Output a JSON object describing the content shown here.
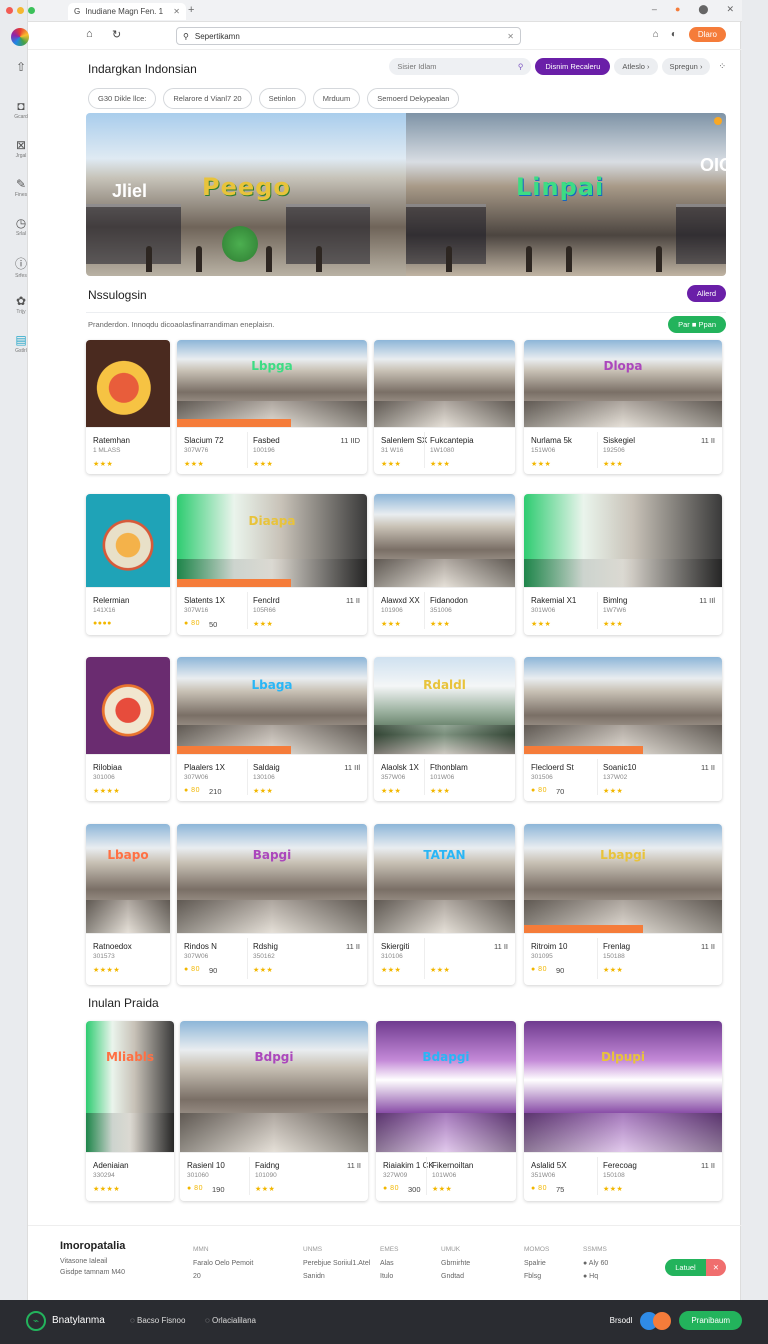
{
  "browser": {
    "tab_title": "Inudiane Magn Fen. 1",
    "url": "Sepertikamn",
    "new_tab": "+",
    "dot_colors": [
      "#f25c54",
      "#f5b730",
      "#3cc15a"
    ]
  },
  "sidebar": {
    "items": [
      {
        "icon": "rocket-icon",
        "glyph": "⇧",
        "label": ""
      },
      {
        "icon": "gamepad-icon",
        "glyph": "◘",
        "label": "Gcard"
      },
      {
        "icon": "tag-icon",
        "glyph": "⊠",
        "label": "Jrgal"
      },
      {
        "icon": "pen-icon",
        "glyph": "✎",
        "label": "Fines"
      },
      {
        "icon": "clock-icon",
        "glyph": "◷",
        "label": "Srlal"
      },
      {
        "icon": "info-icon",
        "glyph": "ⓘ",
        "label": "Srfes"
      },
      {
        "icon": "puzzle-icon",
        "glyph": "✿",
        "label": "Trijy"
      },
      {
        "icon": "folder-icon",
        "glyph": "▤",
        "label": "Gstlrl"
      }
    ]
  },
  "header": {
    "title": "Indargkan Indonsian",
    "search_placeholder": "Sisier Idlam",
    "primary_button": "Disnim Recaleru",
    "grey_button_1": "Atleslo",
    "grey_button_2": "Spregun",
    "action_button": "Dlaro"
  },
  "filters": [
    "G30 Dikle llce:",
    "Relarore d Vianl7 20",
    "Setinlon",
    "Mrduum",
    "Semoerd Dekypealan"
  ],
  "hero": {
    "left_word": "Peego",
    "left_sign": "Jliel",
    "right_word": "Linpai",
    "right_sign": "OIO"
  },
  "section1": {
    "title": "Nssulogsin",
    "pill": "Allerd",
    "hint": "Pranderdon. Innoqdu dicoaolasfinarrandiman eneplaisn.",
    "green_pill": "Par ■ Ppan"
  },
  "cards": [
    {
      "img": "food",
      "t1": "Ratemhan",
      "t2": "1 MLASS",
      "rating": "★★★"
    },
    {
      "img": "mall",
      "sign": "Lbpga",
      "t1": "Slacium 72",
      "t2": "307W76",
      "rating": "★★★",
      "t1b": "Fasbed",
      "t2b": "100196",
      "price": "11 IID",
      "band": true
    },
    {
      "img": "mall",
      "sign": "",
      "t1": "Salenlem SX",
      "t2": "31 W16",
      "rating": "★★★",
      "t1b": "Fukcantepia",
      "t2b": "1W1080",
      "price": ""
    },
    {
      "img": "mall",
      "sign": "Dlopa",
      "t1": "Nurlama 5k",
      "t2": "151W06",
      "rating": "★★★",
      "t1b": "Siskegiel",
      "t2b": "192506",
      "price": "11 II"
    },
    {
      "img": "plate",
      "t1": "Relermian",
      "t2": "141X16",
      "rating": "●●●●"
    },
    {
      "img": "mall-green",
      "sign": "Diaapa",
      "t1": "Slatents 1X",
      "t2": "307W16",
      "rating": "● 80",
      "t1b": "Fenclrd",
      "t2b": "105R66",
      "price": "11 II",
      "band": true,
      "extra": "50"
    },
    {
      "img": "mall",
      "sign": "",
      "t1": "Alawxd XX",
      "t2": "101906",
      "rating": "★★★",
      "t1b": "Fidanodon",
      "t2b": "351006",
      "price": ""
    },
    {
      "img": "mall-green",
      "sign": "",
      "t1": "Rakemial X1",
      "t2": "301W06",
      "rating": "★★★",
      "t1b": "Bimlng",
      "t2b": "1W7W6",
      "price": "11 IIl"
    },
    {
      "img": "plate-purple",
      "t1": "Rilobiaa",
      "t2": "301006",
      "rating": "★★★★"
    },
    {
      "img": "mall",
      "sign": "Lbaga",
      "t1": "Plaalers 1X",
      "t2": "307W06",
      "rating": "● 80",
      "t1b": "Saldaig",
      "t2b": "130106",
      "price": "11 IIl",
      "band": true,
      "extra": "210"
    },
    {
      "img": "mall-outdoor",
      "sign": "Rdaldl",
      "t1": "Alaolsk 1X",
      "t2": "357W06",
      "rating": "★★★",
      "t1b": "Fthonblam",
      "t2b": "101W06",
      "price": ""
    },
    {
      "img": "mall",
      "sign": "",
      "t1": "Flecloerd St",
      "t2": "301506",
      "rating": "● 80",
      "t1b": "Soanic10",
      "t2b": "137W02",
      "price": "11 II",
      "band": true,
      "extra": "70"
    },
    {
      "img": "mall",
      "sign": "Lbapo",
      "t1": "Ratnoedox",
      "t2": "301573",
      "rating": "★★★★"
    },
    {
      "img": "mall",
      "sign": "Bapgi",
      "t1": "Rindos N",
      "t2": "307W06",
      "rating": "● 80",
      "t1b": "Rdshig",
      "t2b": "350162",
      "price": "11 II",
      "extra": "90"
    },
    {
      "img": "mall",
      "sign": "TATAN",
      "t1": "Skiergiti",
      "t2": "310106",
      "rating": "★★★",
      "t1b": "",
      "t2b": "",
      "price": "11 II"
    },
    {
      "img": "mall",
      "sign": "Lbapgi",
      "t1": "Ritroim 10",
      "t2": "301095",
      "rating": "● 80",
      "t1b": "Frenlag",
      "t2b": "150188",
      "price": "11 II",
      "extra": "90",
      "band": true
    }
  ],
  "section2": {
    "title": "Inulan Praida"
  },
  "cards2": [
    {
      "img": "mall-green",
      "sign": "Mliabls",
      "t1": "Adeniaian",
      "t2": "330294",
      "rating": "★★★★"
    },
    {
      "img": "mall",
      "sign": "Bdpgi",
      "t1": "Rasienl 10",
      "t2": "301060",
      "rating": "● 80",
      "t1b": "Faidng",
      "t2b": "101090",
      "price": "11 II",
      "extra": "190"
    },
    {
      "img": "mall-purple",
      "sign": "Bdapgi",
      "t1": "Riaiakim 1 CK",
      "t2": "327W09",
      "rating": "● 80",
      "t1b": "Fikernoiltan",
      "t2b": "101W06",
      "price": "",
      "extra": "300"
    },
    {
      "img": "mall-purple",
      "sign": "Dlpupi",
      "t1": "Aslalid 5X",
      "t2": "351W06",
      "rating": "● 80",
      "t1b": "Ferecoag",
      "t2b": "150108",
      "price": "11 II",
      "extra": "75"
    }
  ],
  "footer": {
    "brand": "Imoropatalia",
    "sub1": "Vitasone Ialeail",
    "sub2": "Gisdpe tamnam M40",
    "cols": [
      {
        "h": "MMN",
        "a": "Faralo Oelo Pemoit",
        "b": "20"
      },
      {
        "h": "UNMS",
        "a": "Perebjue Soriiul1.Atel",
        "b": "Sanidn"
      },
      {
        "h": "EMES",
        "a": "Alas",
        "b": "Itulo"
      },
      {
        "h": "UMUK",
        "a": "Gbrnirhte",
        "b": "Gndtad"
      },
      {
        "h": "MOMOS",
        "a": "Spalrie",
        "b": "Fblsg"
      },
      {
        "h": "SSMMS",
        "a": "● Aly 60",
        "b": "● Hq"
      }
    ],
    "toggle_on": "Latuel",
    "toggle_off": "✕"
  },
  "bottombar": {
    "name": "Bnatylanma",
    "link1": "Bacso Fisnoo",
    "link2": "Orlacialilana",
    "right_label": "Brsodl",
    "button": "Pranibaum"
  }
}
